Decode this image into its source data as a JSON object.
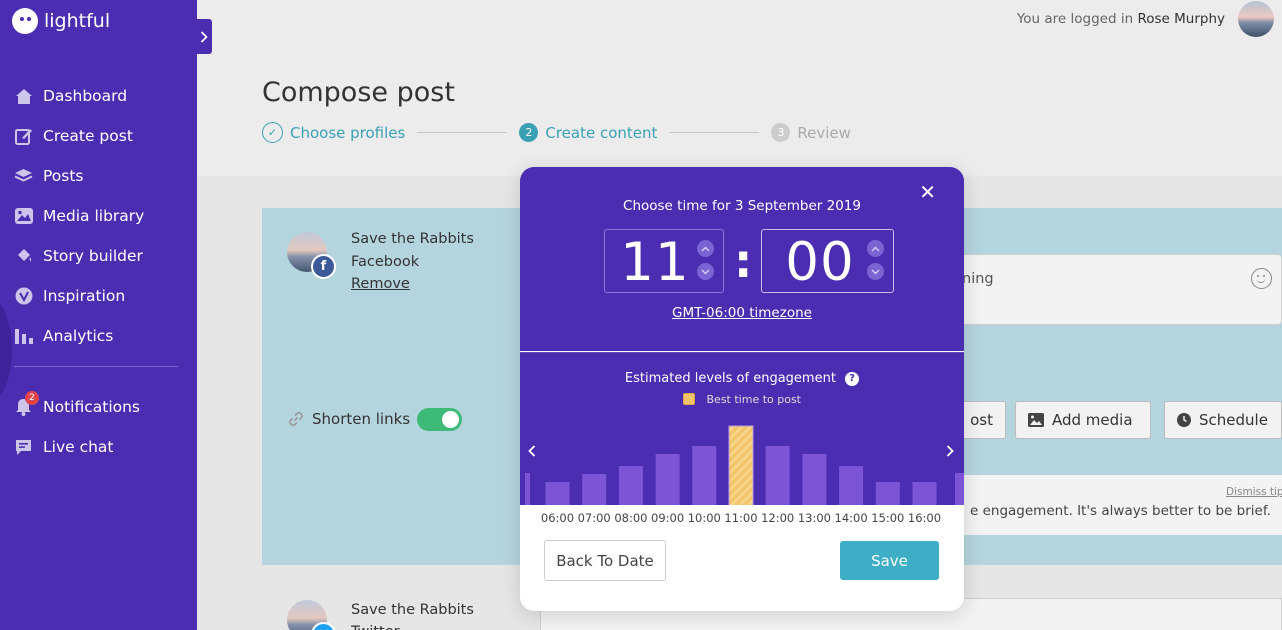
{
  "app": {
    "logo_text": "lightful"
  },
  "sidebar": {
    "items": [
      {
        "label": "Dashboard",
        "icon": "home-icon"
      },
      {
        "label": "Create post",
        "icon": "edit-icon"
      },
      {
        "label": "Posts",
        "icon": "layers-icon"
      },
      {
        "label": "Media library",
        "icon": "image-icon"
      },
      {
        "label": "Story builder",
        "icon": "paint-bucket-icon"
      },
      {
        "label": "Inspiration",
        "icon": "leaf-icon"
      },
      {
        "label": "Analytics",
        "icon": "bar-chart-icon"
      }
    ],
    "secondary": [
      {
        "label": "Notifications",
        "icon": "bell-icon",
        "badge": "2"
      },
      {
        "label": "Live chat",
        "icon": "chat-icon"
      }
    ]
  },
  "header": {
    "login_prefix": "You are logged in",
    "user_name": "Rose Murphy"
  },
  "page": {
    "title": "Compose post",
    "steps": [
      {
        "label": "Choose profiles",
        "state": "done"
      },
      {
        "label": "Create content",
        "number": "2",
        "state": "active"
      },
      {
        "label": "Review",
        "number": "3",
        "state": "todo"
      }
    ]
  },
  "profile": {
    "name": "Save the Rabbits",
    "network": "Facebook",
    "remove_label": "Remove",
    "shorten_links_label": "Shorten links",
    "shorten_links_on": true,
    "post_text_fragment": "ning",
    "buttons": {
      "post_label": "ost",
      "add_media_label": "Add media",
      "schedule_label": "Schedule"
    },
    "tip_text": "e engagement. It's always better to be brief.",
    "dismiss_label": "Dismiss tip"
  },
  "profile2": {
    "name": "Save the Rabbits",
    "network": "Twitter"
  },
  "modal": {
    "title_prefix": "Choose time for",
    "date": "3 September 2019",
    "hour": "11",
    "minute": "00",
    "colon": ":",
    "timezone": "GMT-06:00 timezone",
    "engagement_title": "Estimated levels of engagement",
    "help_symbol": "?",
    "best_time_label": "Best time to post",
    "back_label": "Back To Date",
    "save_label": "Save",
    "close_symbol": "✕",
    "prev_symbol": "‹",
    "next_symbol": "›",
    "colors": {
      "bar": "#7c55d6",
      "best": "#f2c46a",
      "modal_bg": "#4a2db0"
    }
  },
  "chart_data": {
    "type": "bar",
    "categories": [
      "06:00",
      "07:00",
      "08:00",
      "09:00",
      "10:00",
      "11:00",
      "12:00",
      "13:00",
      "14:00",
      "15:00",
      "16:00"
    ],
    "values": [
      3,
      4,
      5,
      6.5,
      7.5,
      10,
      7.5,
      6.5,
      5,
      3,
      3
    ],
    "highlight": "11:00",
    "ylim": [
      0,
      10
    ],
    "title": "Estimated levels of engagement",
    "legend": "Best time to post"
  }
}
